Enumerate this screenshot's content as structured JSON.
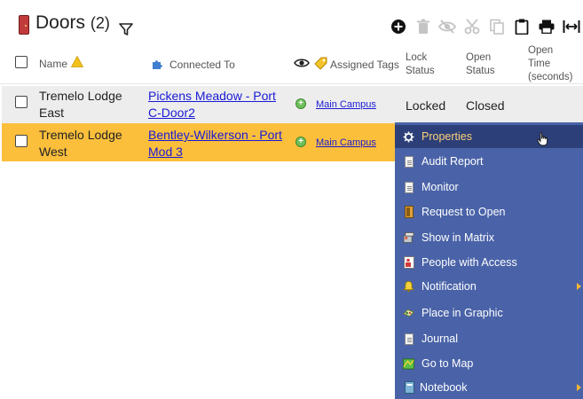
{
  "header": {
    "title": "Doors",
    "count": "(2)"
  },
  "columns": {
    "name": "Name",
    "connected_to": "Connected To",
    "assigned_tags": "Assigned Tags",
    "lock_status_1": "Lock",
    "lock_status_2": "Status",
    "open_status_1": "Open",
    "open_status_2": "Status",
    "open_time_1": "Open",
    "open_time_2": "Time",
    "open_time_3": "(seconds)"
  },
  "rows": [
    {
      "name_1": "Tremelo Lodge",
      "name_2": "East",
      "connected_1": "Pickens Meadow - Port",
      "connected_2": "C-Door2",
      "tag": "Main Campus",
      "lock_status": "Locked",
      "open_status": "Closed"
    },
    {
      "name_1": "Tremelo Lodge",
      "name_2": "West",
      "connected_1": "Bentley-Wilkerson - Port",
      "connected_2": "Mod 3",
      "tag": "Main Campus",
      "lock_status": "",
      "open_status": ""
    }
  ],
  "context_menu": {
    "items": [
      {
        "label": "Properties",
        "icon": "gear-icon"
      },
      {
        "label": "Audit Report",
        "icon": "page-icon"
      },
      {
        "label": "Monitor",
        "icon": "page-icon"
      },
      {
        "label": "Request to Open",
        "icon": "door-icon"
      },
      {
        "label": "Show in Matrix",
        "icon": "matrix-icon"
      },
      {
        "label": "People with Access",
        "icon": "people-icon"
      },
      {
        "label": "Notification",
        "icon": "bell-icon"
      },
      {
        "label": "Place in Graphic",
        "icon": "graphic-icon"
      },
      {
        "label": "Journal",
        "icon": "page-icon"
      },
      {
        "label": "Go to Map",
        "icon": "map-icon"
      },
      {
        "label": "Notebook",
        "icon": "notebook-icon"
      }
    ]
  },
  "colors": {
    "selected_row": "#fbbf3c",
    "menu_bg": "#4a63a8",
    "menu_active": "#2c3f78",
    "link": "#1a1ad6"
  }
}
